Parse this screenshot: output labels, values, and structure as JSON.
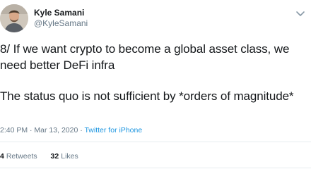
{
  "author": {
    "display_name": "Kyle Samani",
    "handle": "@KyleSamani",
    "avatar_icon": "person-avatar-icon"
  },
  "menu_icon": "chevron-down-icon",
  "tweet": {
    "paragraphs": [
      "8/ If we want crypto to become a global asset class, we need better DeFi infra",
      "The status quo is not sufficient by *orders of magnitude*"
    ]
  },
  "meta": {
    "timestamp": "2:40 PM · Mar 13, 2020 ·",
    "source": "Twitter for iPhone"
  },
  "stats": {
    "retweets_count": "4",
    "retweets_label": "Retweets",
    "likes_count": "32",
    "likes_label": "Likes"
  },
  "colors": {
    "link": "#1b95e0",
    "secondary_text": "#657786",
    "divider": "#e6ecf0"
  }
}
